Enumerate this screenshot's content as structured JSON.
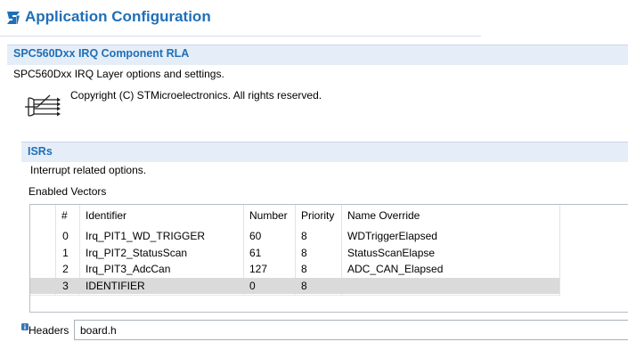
{
  "window": {
    "title": "Application Configuration"
  },
  "component": {
    "title": "SPC560Dxx IRQ Component RLA",
    "description": "SPC560Dxx IRQ Layer options and settings.",
    "copyright": "Copyright (C) STMicroelectronics. All rights reserved."
  },
  "isrs": {
    "title": "ISRs",
    "description": "Interrupt related options.",
    "enabled_vectors_label": "Enabled Vectors",
    "columns": [
      "#",
      "Identifier",
      "Number",
      "Priority",
      "Name Override"
    ],
    "rows": [
      {
        "index": "0",
        "identifier": "Irq_PIT1_WD_TRIGGER",
        "number": "60",
        "priority": "8",
        "name_override": "WDTriggerElapsed"
      },
      {
        "index": "1",
        "identifier": "Irq_PIT2_StatusScan",
        "number": "61",
        "priority": "8",
        "name_override": "StatusScanElapse"
      },
      {
        "index": "2",
        "identifier": "Irq_PIT3_AdcCan",
        "number": "127",
        "priority": "8",
        "name_override": "ADC_CAN_Elapsed"
      },
      {
        "index": "3",
        "identifier": "IDENTIFIER",
        "number": "0",
        "priority": "8",
        "name_override": ""
      }
    ],
    "selected_row": 3
  },
  "headers": {
    "label": "Headers",
    "value": "board.h"
  },
  "colors": {
    "accent": "#1f6fb8",
    "section_header_bg": "#e5eef8",
    "selected_row_bg": "#dadada"
  }
}
